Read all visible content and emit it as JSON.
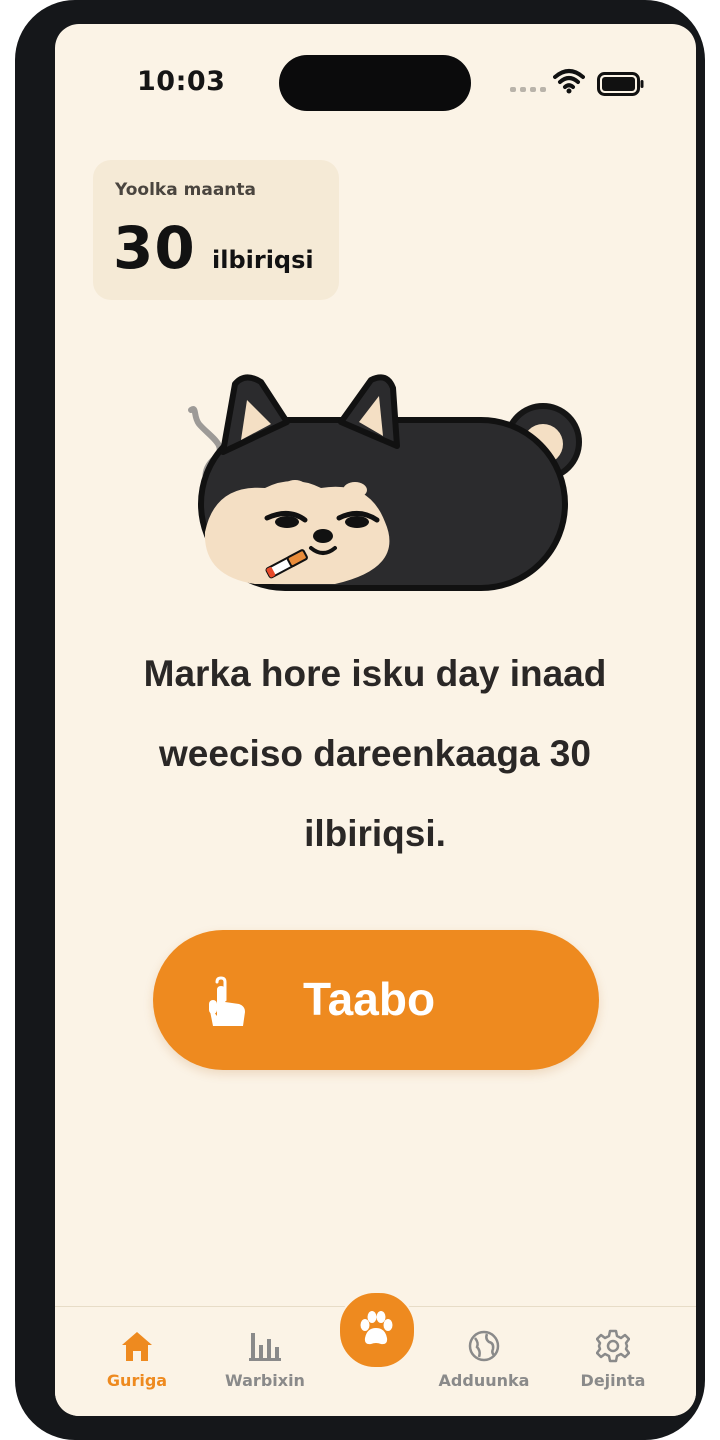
{
  "status_bar": {
    "time": "10:03"
  },
  "today": {
    "label": "Yoolka maanta",
    "value": "30",
    "unit": "ilbiriqsi"
  },
  "message": "Marka hore isku day inaad weeciso dareenkaaga 30 ilbiriqsi.",
  "tap_button": {
    "label": "Taabo"
  },
  "tabbar": {
    "items": [
      {
        "label": "Guriga",
        "icon": "home-icon",
        "active": true
      },
      {
        "label": "Warbixin",
        "icon": "bar-chart-icon",
        "active": false
      },
      {
        "label": "",
        "icon": "paw-icon",
        "active": false
      },
      {
        "label": "Adduunka",
        "icon": "globe-icon",
        "active": false
      },
      {
        "label": "Dejinta",
        "icon": "gear-icon",
        "active": false
      }
    ]
  },
  "colors": {
    "accent": "#ee8a1f",
    "background": "#fbf3e6",
    "card": "#f5ead6",
    "text": "#2a2726"
  }
}
